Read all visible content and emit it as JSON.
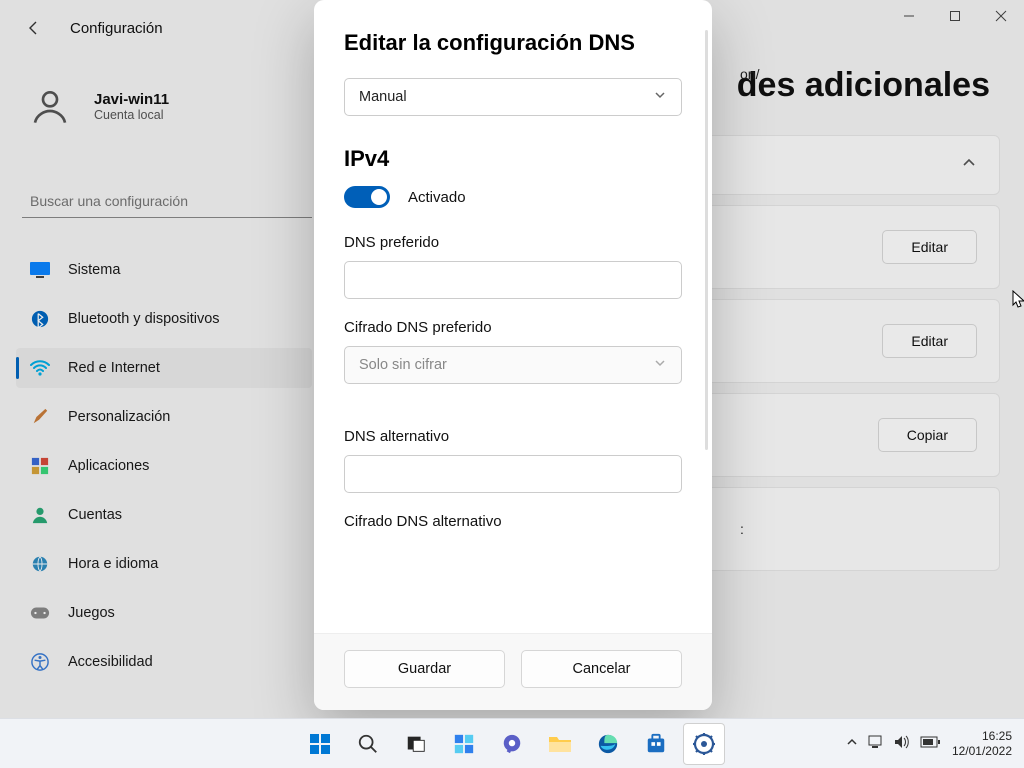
{
  "app": {
    "title": "Configuración"
  },
  "user": {
    "name": "Javi-win11",
    "sub": "Cuenta local"
  },
  "search": {
    "placeholder": "Buscar una configuración"
  },
  "nav": [
    {
      "label": "Sistema",
      "icon": "monitor"
    },
    {
      "label": "Bluetooth y dispositivos",
      "icon": "bluetooth"
    },
    {
      "label": "Red e Internet",
      "icon": "wifi",
      "active": true
    },
    {
      "label": "Personalización",
      "icon": "brush"
    },
    {
      "label": "Aplicaciones",
      "icon": "apps"
    },
    {
      "label": "Cuentas",
      "icon": "person"
    },
    {
      "label": "Hora e idioma",
      "icon": "globe"
    },
    {
      "label": "Juegos",
      "icon": "game"
    },
    {
      "label": "Accesibilidad",
      "icon": "accessibility"
    }
  ],
  "page": {
    "title_fragment": "des adicionales",
    "btn_edit": "Editar",
    "btn_copy": "Copiar",
    "mid1": "on/",
    "mid2": ":"
  },
  "modal": {
    "title": "Editar la configuración DNS",
    "mode": "Manual",
    "section": "IPv4",
    "toggle_label": "Activado",
    "field_preferred": "DNS preferido",
    "field_preferred_enc": "Cifrado DNS preferido",
    "enc_value": "Solo sin cifrar",
    "field_alt": "DNS alternativo",
    "field_alt_enc": "Cifrado DNS alternativo",
    "btn_save": "Guardar",
    "btn_cancel": "Cancelar"
  },
  "tray": {
    "time": "16:25",
    "date": "12/01/2022"
  }
}
